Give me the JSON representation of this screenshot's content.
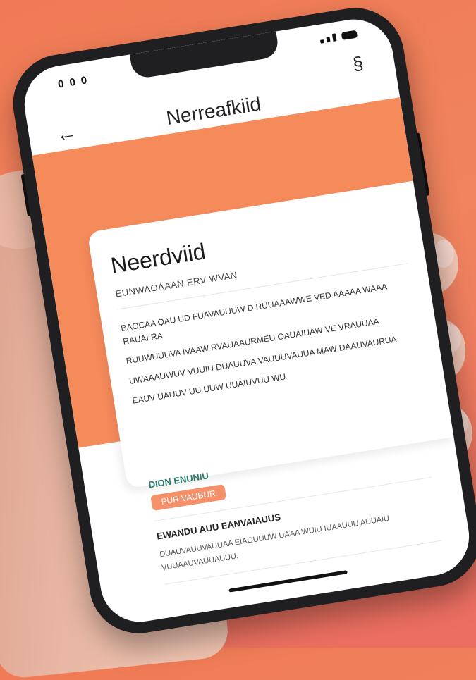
{
  "status_bar": {
    "left": "0 0 0"
  },
  "header": {
    "back_icon": "arrow-left-icon",
    "title": "Nerreafkiid",
    "menu_icon": "menu-icon"
  },
  "card": {
    "title": "Neerdviid",
    "subtitle": "Eunwaoaaan erv wvan",
    "paragraphs": [
      "Baocaa qau ud fuavauuuw d ruuaaawwe ved aaaaa Waaa Rauai ra",
      "Ruuwuuuva ivaaw rvauaaurmeu oauaiuaw ve vrauuaa",
      "Uwaaauwuv vuuiu duauuva vauuuvauua maw daauvaurua",
      "Eauv uauuv uu uuw uuaiuvuu wu"
    ]
  },
  "section": {
    "label": "Dion enuniu",
    "chip": "Pur vaubur",
    "heading": "Ewandu auu eanvaiauus",
    "body": "Duauvauuvauuaa eiaouuuw uaaa wuiu iuaauuu auuaiu vuuaauvauuauuu."
  },
  "colors": {
    "accent": "#f58a5b",
    "chip": "#f4916a",
    "label": "#2b7a6a",
    "background": "#f07a55"
  }
}
